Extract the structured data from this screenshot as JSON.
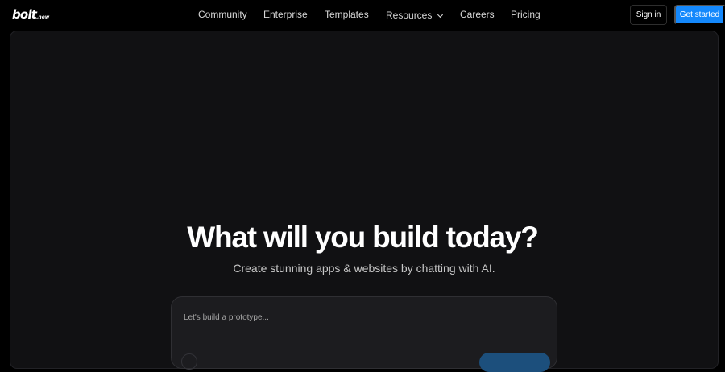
{
  "brand": {
    "logo_main": "bolt",
    "logo_sub": ".new"
  },
  "nav": {
    "community": "Community",
    "enterprise": "Enterprise",
    "templates": "Templates",
    "resources": "Resources",
    "careers": "Careers",
    "pricing": "Pricing"
  },
  "auth": {
    "sign_in": "Sign in",
    "get_started": "Get started"
  },
  "hero": {
    "title": "What will you build today?",
    "subtitle": "Create stunning apps & websites by chatting with AI."
  },
  "prompt": {
    "placeholder": "Let's build a prototype..."
  },
  "colors": {
    "accent": "#1488fc",
    "background": "#000000",
    "panel": "#111113"
  },
  "icons": {
    "resources_chevron": "chevron-down-icon"
  }
}
